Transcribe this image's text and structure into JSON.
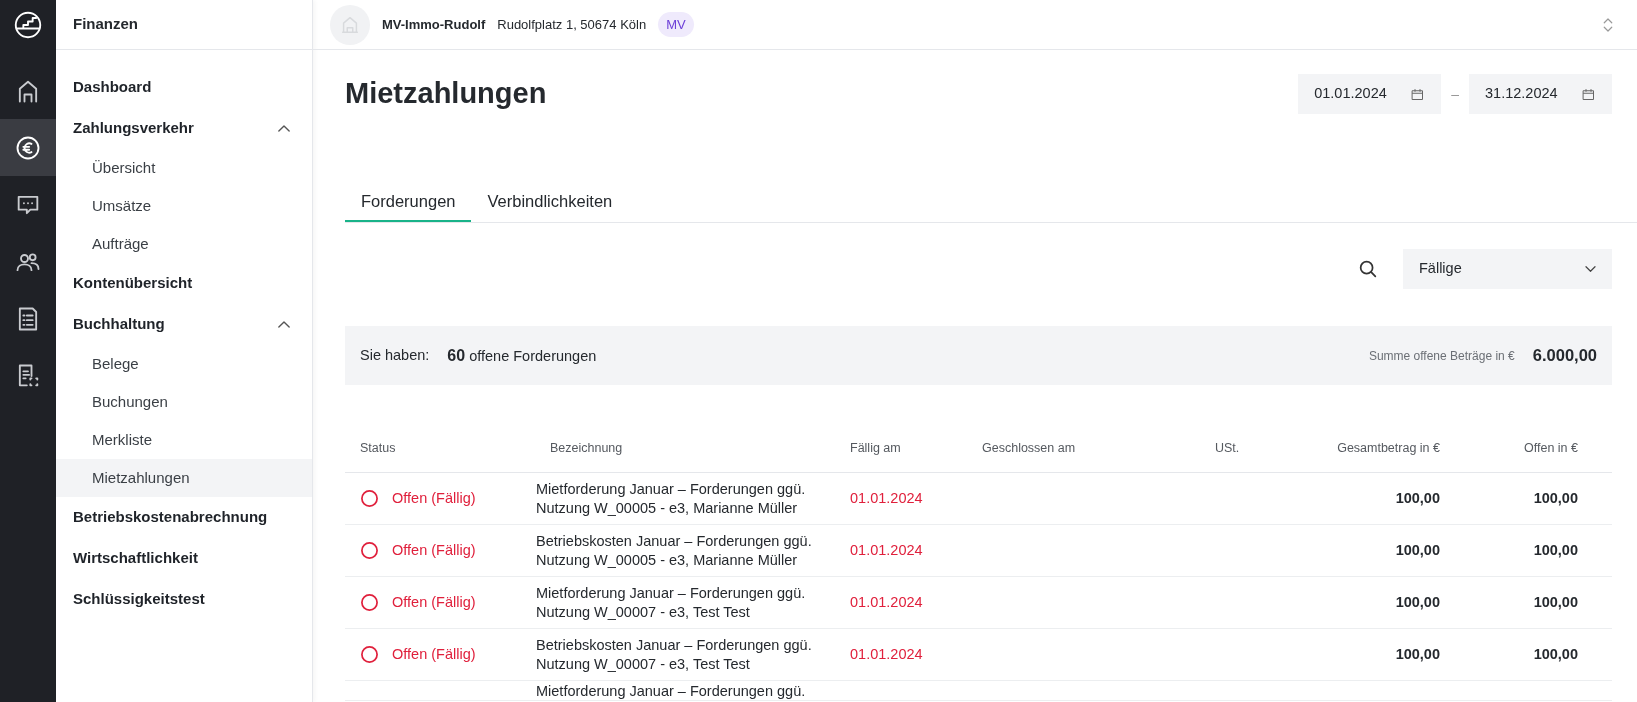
{
  "rail": [
    {
      "selected": false
    },
    {
      "selected": true
    },
    {
      "selected": false
    },
    {
      "selected": false
    },
    {
      "selected": false
    },
    {
      "selected": false
    }
  ],
  "sidebar": {
    "title": "Finanzen",
    "items": [
      {
        "label": "Dashboard",
        "selected": false
      },
      {
        "label": "Zahlungsverkehr",
        "selected": false,
        "expanded": true,
        "children": [
          {
            "label": "Übersicht",
            "selected": false
          },
          {
            "label": "Umsätze",
            "selected": false
          },
          {
            "label": "Aufträge",
            "selected": false
          }
        ]
      },
      {
        "label": "Kontenübersicht",
        "selected": false
      },
      {
        "label": "Buchhaltung",
        "selected": false,
        "expanded": true,
        "children": [
          {
            "label": "Belege",
            "selected": false
          },
          {
            "label": "Buchungen",
            "selected": false
          },
          {
            "label": "Merkliste",
            "selected": false
          },
          {
            "label": "Mietzahlungen",
            "selected": true
          }
        ]
      },
      {
        "label": "Betriebskostenabrechnung",
        "selected": false
      },
      {
        "label": "Wirtschaftlichkeit",
        "selected": false
      },
      {
        "label": "Schlüssigkeitstest",
        "selected": false
      }
    ]
  },
  "header": {
    "property": "MV-Immo-Rudolf",
    "address": "Rudolfplatz 1, 50674 Köln",
    "badge": "MV"
  },
  "page": {
    "title": "Mietzahlungen",
    "date_from": "01.01.2024",
    "date_separator": "–",
    "date_to": "31.12.2024"
  },
  "tabs": [
    {
      "label": "Forderungen",
      "selected": true
    },
    {
      "label": "Verbindlichkeiten",
      "selected": false
    }
  ],
  "filter": {
    "value": "Fällige"
  },
  "summary": {
    "prefix": "Sie haben:",
    "count_text": "**60** offene Forderungen",
    "total_label": "Summe offene Beträge in €",
    "total": "6.000,00"
  },
  "table": {
    "columns": [
      "Status",
      "Bezeichnung",
      "Fällig am",
      "Geschlossen am",
      "USt.",
      "Gesamtbetrag in €",
      "Offen in €"
    ],
    "rows": [
      {
        "status": "Offen (Fällig)",
        "description": [
          "Mietforderung Januar – Forderungen ggü.",
          "Nutzung W_00005 - e3, Marianne Müller"
        ],
        "due": "01.01.2024",
        "total": "100,00",
        "open": "100,00"
      },
      {
        "status": "Offen (Fällig)",
        "description": [
          "Betriebskosten Januar – Forderungen ggü.",
          "Nutzung W_00005 - e3, Marianne Müller"
        ],
        "due": "01.01.2024",
        "total": "100,00",
        "open": "100,00"
      },
      {
        "status": "Offen (Fällig)",
        "description": [
          "Mietforderung Januar – Forderungen ggü.",
          "Nutzung W_00007 - e3, Test Test"
        ],
        "due": "01.01.2024",
        "total": "100,00",
        "open": "100,00"
      },
      {
        "status": "Offen (Fällig)",
        "description": [
          "Betriebskosten Januar – Forderungen ggü.",
          "Nutzung W_00007 - e3, Test Test"
        ],
        "due": "01.01.2024",
        "total": "100,00",
        "open": "100,00"
      },
      {
        "description": [
          "Mietforderung Januar – Forderungen ggü."
        ]
      }
    ]
  }
}
